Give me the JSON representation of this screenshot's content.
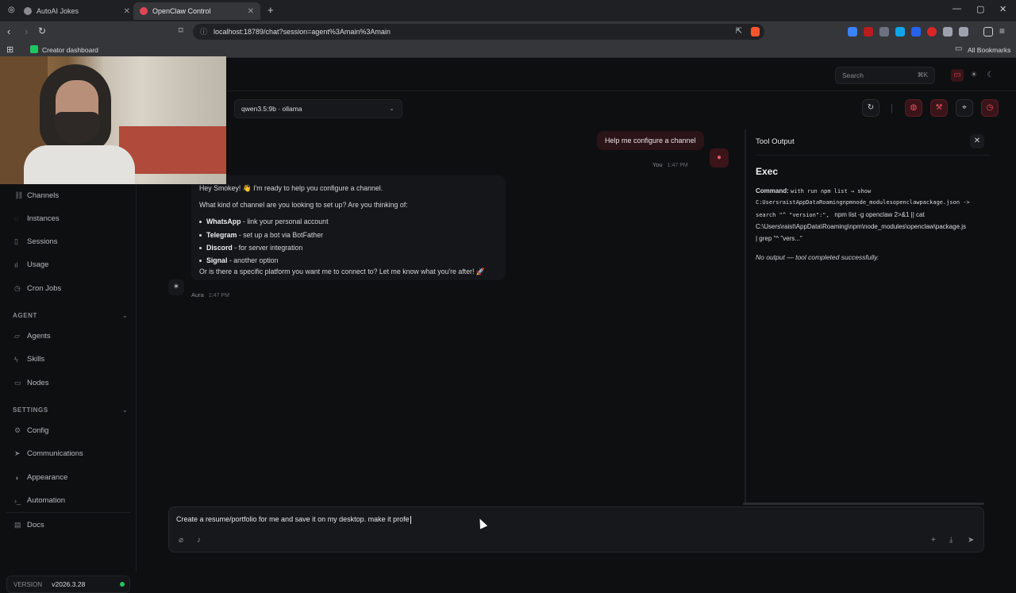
{
  "browser": {
    "tabs": [
      {
        "label": "AutoAI Jokes",
        "active": false
      },
      {
        "label": "OpenClaw Control",
        "active": true
      }
    ],
    "url": "localhost:18789/chat?session=agent%3Amain%3Amain",
    "bookmarks": {
      "item": "Creator dashboard",
      "all": "All Bookmarks"
    }
  },
  "app": {
    "search": {
      "placeholder": "Search",
      "shortcut": "⌘K"
    },
    "model": "qwen3.5:9b · ollama"
  },
  "sidebar": {
    "items_top": [
      {
        "label": "Channels",
        "icon": "link-icon"
      },
      {
        "label": "Instances",
        "icon": "radio-icon"
      },
      {
        "label": "Sessions",
        "icon": "file-icon"
      },
      {
        "label": "Usage",
        "icon": "bar-chart-icon"
      },
      {
        "label": "Cron Jobs",
        "icon": "clock-icon"
      }
    ],
    "section_agent": "AGENT",
    "items_agent": [
      {
        "label": "Agents",
        "icon": "folder-icon"
      },
      {
        "label": "Skills",
        "icon": "bolt-icon"
      },
      {
        "label": "Nodes",
        "icon": "monitor-icon"
      }
    ],
    "section_settings": "SETTINGS",
    "items_settings": [
      {
        "label": "Config",
        "icon": "gear-icon"
      },
      {
        "label": "Communications",
        "icon": "send-icon"
      },
      {
        "label": "Appearance",
        "icon": "palette-icon"
      },
      {
        "label": "Automation",
        "icon": "terminal-icon"
      }
    ],
    "docs": "Docs",
    "version_label": "VERSION",
    "version": "v2026.3.28"
  },
  "chat": {
    "user_message": "Help me configure a channel",
    "user_name": "You",
    "user_time": "1:47 PM",
    "assistant": {
      "greeting": "Hey Smokey! 👋 I'm ready to help you configure a channel.",
      "question": "What kind of channel are you looking to set up? Are you thinking of:",
      "options": [
        {
          "name": "WhatsApp",
          "desc": " - link your personal account"
        },
        {
          "name": "Telegram",
          "desc": " - set up a bot via BotFather"
        },
        {
          "name": "Discord",
          "desc": " - for server integration"
        },
        {
          "name": "Signal",
          "desc": " - another option"
        }
      ],
      "closing": "Or is there a specific platform you want me to connect to? Let me know what you're after! 🚀",
      "name": "Aura",
      "time": "1:47 PM"
    }
  },
  "tool_output": {
    "header": "Tool Output",
    "title": "Exec",
    "command_label": "Command:",
    "command_lines": [
      "with run npm list → show",
      "C:UsersraistAppDataRoamingnpmnode_modulesopenclawpackage.json ->",
      "search \"^ \"version\":\",",
      "npm list -g openclaw 2>&1 || cat",
      "C:\\Users\\raist\\AppData\\Roaming\\npm\\node_modules\\openclaw\\package.js",
      "| grep \"^ \"vers...\""
    ],
    "result": "No output — tool completed successfully."
  },
  "composer": {
    "text": "Create a resume/portfolio for me and save it on my desktop. make it profe"
  },
  "colors": {
    "accent": "#ef5463",
    "status_online": "#22c55e"
  }
}
